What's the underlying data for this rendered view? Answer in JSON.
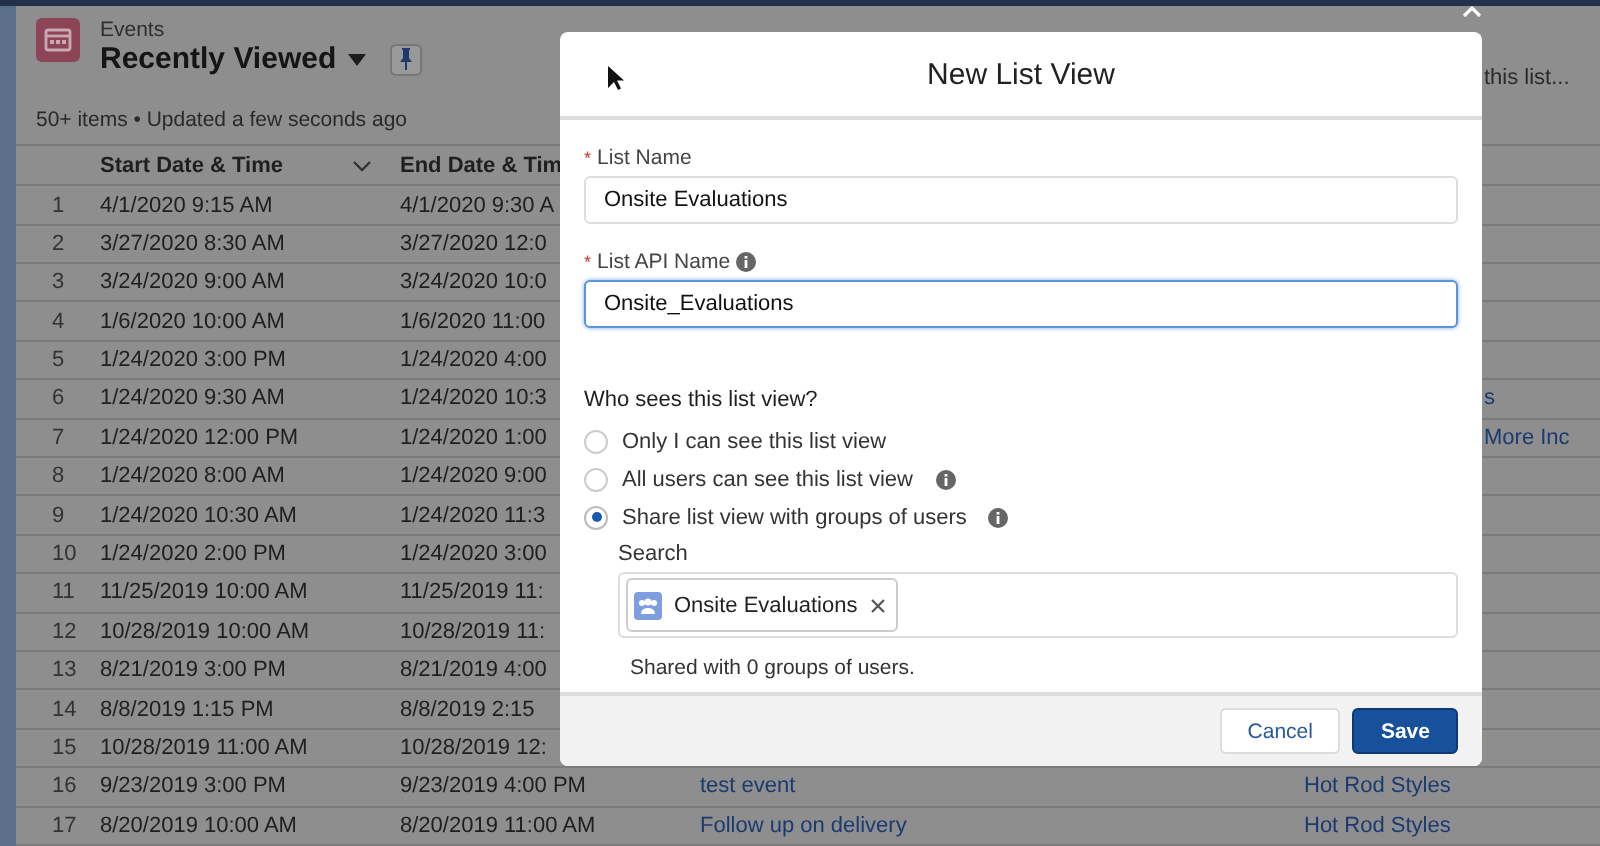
{
  "page": {
    "object_label": "Events",
    "list_title": "Recently Viewed",
    "status": "50+ items • Updated a few seconds ago",
    "search": {
      "placeholder": "this list..."
    }
  },
  "table": {
    "columns": [
      {
        "label": "Start Date & Time"
      },
      {
        "label": "End Date & Tim"
      }
    ],
    "rows": [
      {
        "num": "1",
        "start": "4/1/2020 9:15 AM",
        "end": "4/1/2020 9:30 A"
      },
      {
        "num": "2",
        "start": "3/27/2020 8:30 AM",
        "end": "3/27/2020 12:0"
      },
      {
        "num": "3",
        "start": "3/24/2020 9:00 AM",
        "end": "3/24/2020 10:0"
      },
      {
        "num": "4",
        "start": "1/6/2020 10:00 AM",
        "end": "1/6/2020 11:00"
      },
      {
        "num": "5",
        "start": "1/24/2020 3:00 PM",
        "end": "1/24/2020 4:00"
      },
      {
        "num": "6",
        "start": "1/24/2020 9:30 AM",
        "end": "1/24/2020 10:3",
        "account": "s",
        "account_cut": true
      },
      {
        "num": "7",
        "start": "1/24/2020 12:00 PM",
        "end": "1/24/2020 1:00",
        "account": "More Inc",
        "account_cut": true
      },
      {
        "num": "8",
        "start": "1/24/2020 8:00 AM",
        "end": "1/24/2020 9:00"
      },
      {
        "num": "9",
        "start": "1/24/2020 10:30 AM",
        "end": "1/24/2020 11:3"
      },
      {
        "num": "10",
        "start": "1/24/2020 2:00 PM",
        "end": "1/24/2020 3:00"
      },
      {
        "num": "11",
        "start": "11/25/2019 10:00 AM",
        "end": "11/25/2019 11:"
      },
      {
        "num": "12",
        "start": "10/28/2019 10:00 AM",
        "end": "10/28/2019 11:"
      },
      {
        "num": "13",
        "start": "8/21/2019 3:00 PM",
        "end": "8/21/2019 4:00"
      },
      {
        "num": "14",
        "start": "8/8/2019 1:15 PM",
        "end": "8/8/2019 2:15"
      },
      {
        "num": "15",
        "start": "10/28/2019 11:00 AM",
        "end": "10/28/2019 12:"
      },
      {
        "num": "16",
        "start": "9/23/2019 3:00 PM",
        "end": "9/23/2019 4:00 PM",
        "subject": "test event",
        "account": "Hot Rod Styles",
        "account_cut": false
      },
      {
        "num": "17",
        "start": "8/20/2019 10:00 AM",
        "end": "8/20/2019 11:00 AM",
        "subject": "Follow up on delivery",
        "account": "Hot Rod Styles",
        "account_cut": false
      }
    ]
  },
  "modal": {
    "title": "New List View",
    "fields": [
      {
        "label": "List Name",
        "required_mark": "*",
        "info": false,
        "value": "Onsite Evaluations",
        "focused": false
      },
      {
        "label": "List API Name",
        "required_mark": "*",
        "info": true,
        "value": "Onsite_Evaluations",
        "focused": true
      }
    ],
    "visibility": {
      "question": "Who sees this list view?",
      "options": [
        {
          "label": "Only I can see this list view",
          "selected": false,
          "info": false
        },
        {
          "label": "All users can see this list view",
          "selected": false,
          "info": true
        },
        {
          "label": "Share list view with groups of users",
          "selected": true,
          "info": true
        }
      ],
      "search_label": "Search",
      "pills": [
        {
          "label": "Onsite Evaluations"
        }
      ],
      "shared_note": "Shared with 0 groups of users."
    },
    "buttons": [
      {
        "label": "Cancel",
        "kind": "neutral"
      },
      {
        "label": "Save",
        "kind": "brand"
      }
    ]
  }
}
